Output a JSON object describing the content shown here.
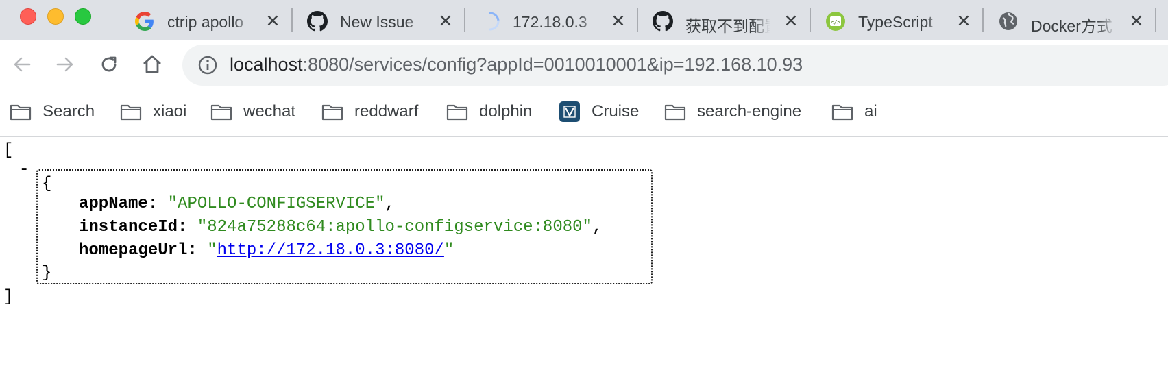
{
  "tabs": [
    {
      "title": "ctrip apollo",
      "icon": "google-icon"
    },
    {
      "title": "New Issue",
      "icon": "github-icon"
    },
    {
      "title": "172.18.0.3",
      "icon": "loading-spinner-icon"
    },
    {
      "title": "获取不到配置",
      "icon": "github-icon"
    },
    {
      "title": "TypeScript",
      "icon": "code-icon"
    },
    {
      "title": "Docker方式",
      "icon": "globe-icon"
    }
  ],
  "tab_close_glyph": "✕",
  "address_bar": {
    "host": "localhost",
    "path": ":8080/services/config?appId=0010010001&ip=192.168.10.93"
  },
  "bookmarks": [
    {
      "label": "Search",
      "icon": "folder-icon"
    },
    {
      "label": "xiaoi",
      "icon": "folder-icon"
    },
    {
      "label": "wechat",
      "icon": "folder-icon"
    },
    {
      "label": "reddwarf",
      "icon": "folder-icon"
    },
    {
      "label": "dolphin",
      "icon": "folder-icon"
    },
    {
      "label": "Cruise",
      "icon": "cruise-app-icon"
    },
    {
      "label": "search-engine",
      "icon": "folder-icon"
    },
    {
      "label": "ai",
      "icon": "folder-icon"
    }
  ],
  "json_view": {
    "open_bracket": "[",
    "close_bracket": "]",
    "collapse_toggle": "-",
    "open_brace": "{",
    "close_brace": "}",
    "fields": [
      {
        "key": "appName",
        "value": "APOLLO-CONFIGSERVICE",
        "is_link": false,
        "comma": true
      },
      {
        "key": "instanceId",
        "value": "824a75288c64:apollo-configservice:8080",
        "is_link": false,
        "comma": true
      },
      {
        "key": "homepageUrl",
        "value": "http://172.18.0.3:8080/",
        "is_link": true,
        "comma": false
      }
    ]
  },
  "colors": {
    "tabstrip_bg": "#dee1e6",
    "string_value": "#2f8a1e",
    "link": "#0000ee"
  }
}
